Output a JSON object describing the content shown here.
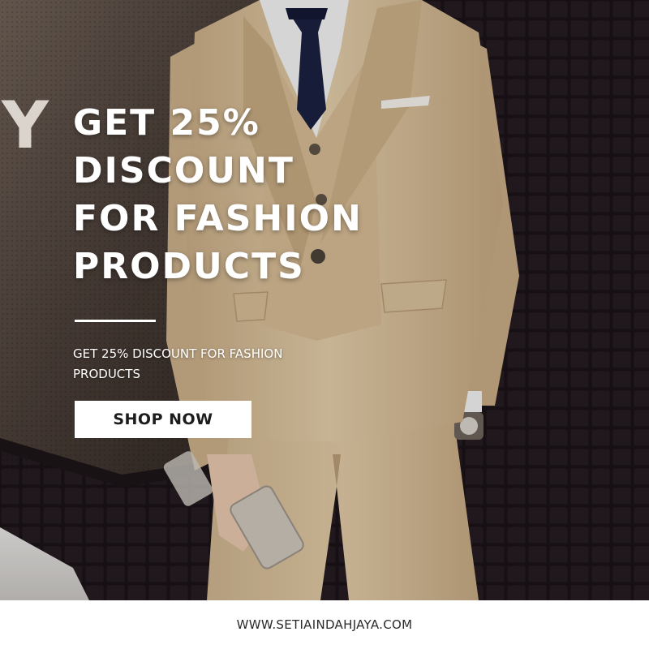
{
  "banner": {
    "headline_lines": [
      "GET 25%",
      "DISCOUNT",
      "FOR FASHION",
      "PRODUCTS"
    ],
    "subtitle": "GET 25% DISCOUNT FOR FASHION PRODUCTS",
    "cta_label": "SHOP NOW",
    "website": "WWW.SETIAINDAHJAYA.COM",
    "store_sign_letter": "Y"
  },
  "colors": {
    "text": "#ffffff",
    "button_bg": "#ffffff",
    "button_text": "#1c1c1c",
    "suit": "#d9c09a",
    "tie": "#1b2140",
    "wall": "#1c1418"
  }
}
